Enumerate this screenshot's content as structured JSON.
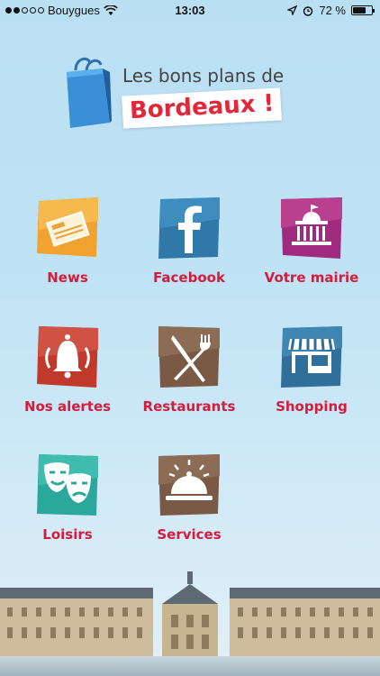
{
  "status": {
    "carrier": "Bouygues",
    "time": "13:03",
    "battery_percent": "72 %",
    "battery_level": 0.72,
    "icons": [
      "signal-dots-icon",
      "wifi-icon",
      "location-arrow-icon",
      "alarm-icon",
      "battery-icon"
    ]
  },
  "logo": {
    "line1": "Les bons plans de",
    "line2": "Bordeaux !",
    "icon": "shopping-bag-icon"
  },
  "tiles": [
    {
      "label": "News",
      "icon": "newspaper-icon",
      "color": "#f2a22f"
    },
    {
      "label": "Facebook",
      "icon": "facebook-icon",
      "color": "#2f78a8"
    },
    {
      "label": "Votre mairie",
      "icon": "town-hall-icon",
      "color": "#a02a7d"
    },
    {
      "label": "Nos alertes",
      "icon": "bell-icon",
      "color": "#c0392b"
    },
    {
      "label": "Restaurants",
      "icon": "knife-fork-icon",
      "color": "#7a5a45"
    },
    {
      "label": "Shopping",
      "icon": "shop-icon",
      "color": "#2f6f99"
    },
    {
      "label": "Loisirs",
      "icon": "theater-masks-icon",
      "color": "#2aa89a"
    },
    {
      "label": "Services",
      "icon": "service-bell-icon",
      "color": "#7a5a45"
    }
  ],
  "label_color": "#d21d3f"
}
